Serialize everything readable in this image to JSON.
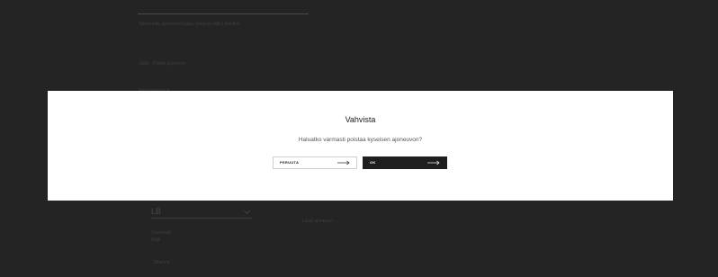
{
  "background": {
    "line1": "Tallennettu ajoneuvo kuuluu oman profiilisi tietoihin",
    "line2": "Jatko · Poista ajoneuvo",
    "line3": "Rekisteritunnus",
    "select_value": "LB",
    "label_a": "Vuosimalli",
    "label_b": "Malli",
    "link": "Lisää ajoneuvo →",
    "button": "Tallenna"
  },
  "dialog": {
    "title": "Vahvista",
    "message": "Haluatko varmasti poistaa kyseisen ajoneuvon?",
    "cancel_label": "PERUUTA",
    "ok_label": "OK"
  },
  "icons": {
    "cancel_arrow": "arrow-right-icon",
    "ok_arrow": "arrow-right-icon"
  },
  "colors": {
    "overlay": "#222222",
    "dialog_bg": "#ffffff",
    "ok_bg": "#1e1e1e"
  }
}
